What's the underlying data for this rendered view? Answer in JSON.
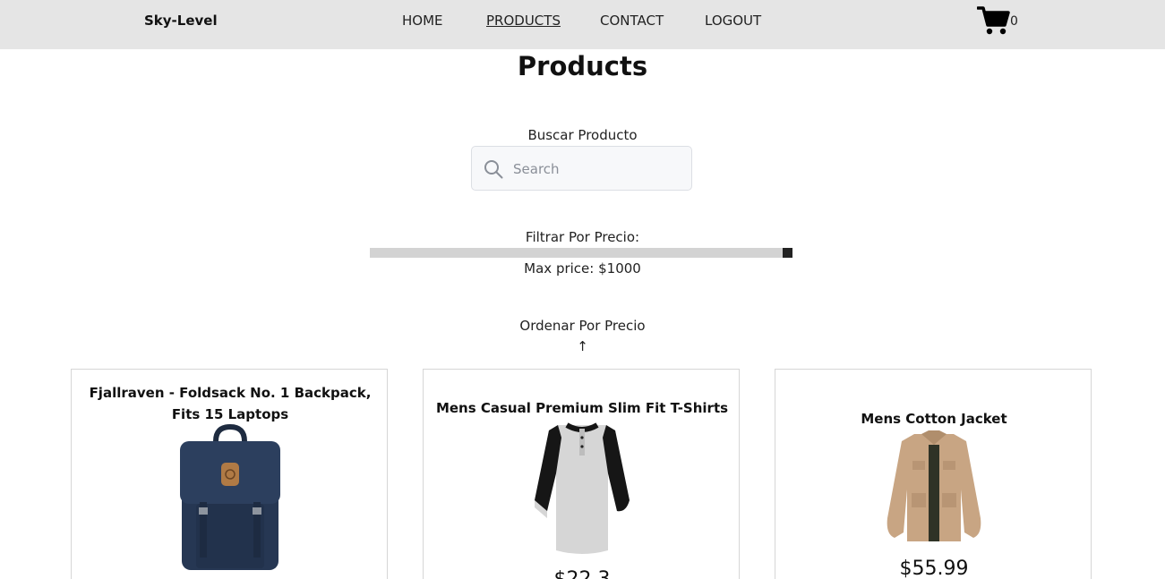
{
  "nav": {
    "brand": "Sky-Level",
    "links": [
      "HOME",
      "PRODUCTS",
      "CONTACT",
      "LOGOUT"
    ],
    "active": "PRODUCTS",
    "cart_count": "0"
  },
  "page": {
    "title": "Products"
  },
  "search": {
    "label": "Buscar Producto",
    "placeholder": "Search",
    "value": ""
  },
  "price_filter": {
    "label": "Filtrar Por Precio:",
    "max_label": "Max price: $1000",
    "level_fraction": 1.0
  },
  "sort": {
    "label": "Ordenar Por Precio",
    "arrow": "↑"
  },
  "products": [
    {
      "title": "Fjallraven - Foldsack No. 1 Backpack, Fits 15 Laptops",
      "image": "backpack-image",
      "price": ""
    },
    {
      "title": "Mens Casual Premium Slim Fit T-Shirts",
      "image": "tshirt-image",
      "price": "$22.3"
    },
    {
      "title": "Mens Cotton Jacket",
      "image": "jacket-image",
      "price": "$55.99"
    }
  ],
  "colors": {
    "navbar_bg": "#e5e5e5",
    "slider_track": "#d3d3d3",
    "slider_thumb": "#222222"
  }
}
